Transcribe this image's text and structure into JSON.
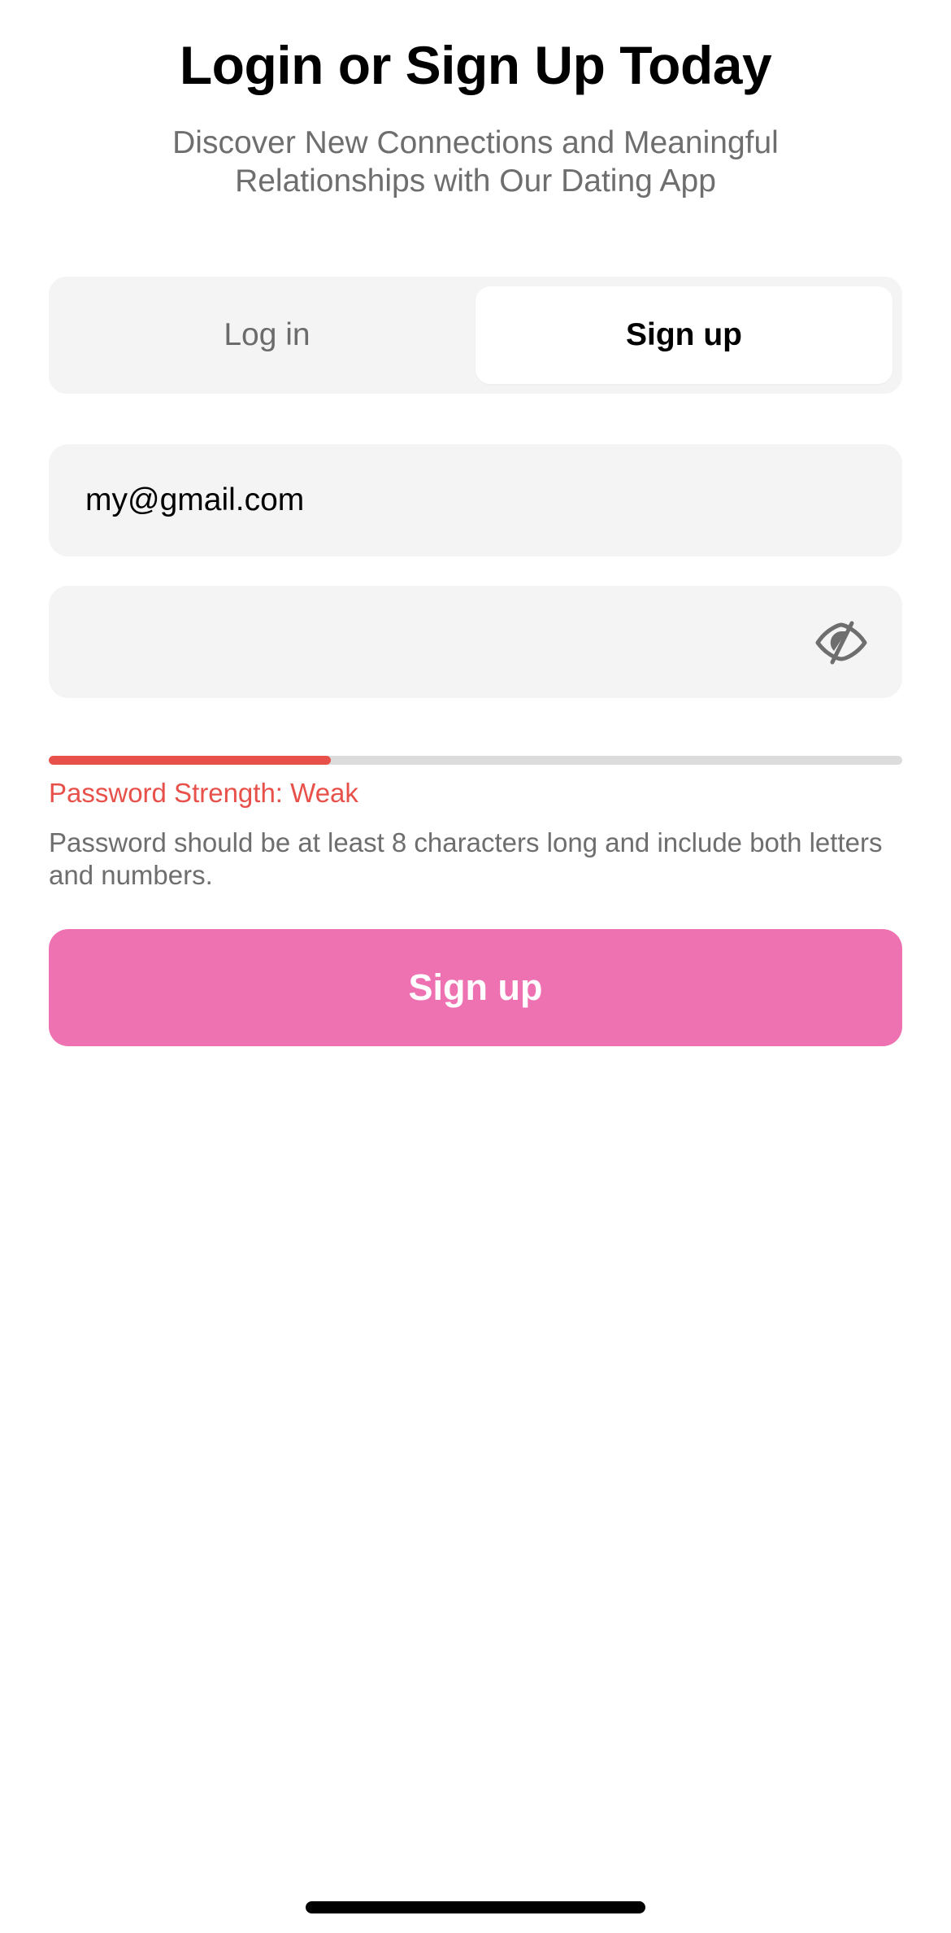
{
  "header": {
    "title": "Login or Sign Up Today",
    "subtitle": "Discover New Connections and Meaningful Relationships with Our Dating App"
  },
  "tabs": [
    {
      "label": "Log in",
      "selected": false
    },
    {
      "label": "Sign up",
      "selected": true
    }
  ],
  "form": {
    "email_value": "my@gmail.com",
    "password_value": "",
    "password_toggle_icon": "eye-slash-icon"
  },
  "strength": {
    "level": 0.33,
    "label": "Password Strength: Weak",
    "hint": "Password should be at least 8 characters long and include both letters and numbers.",
    "color": "#e8504a"
  },
  "actions": {
    "submit_label": "Sign up",
    "accent_color": "#ee72b1"
  }
}
